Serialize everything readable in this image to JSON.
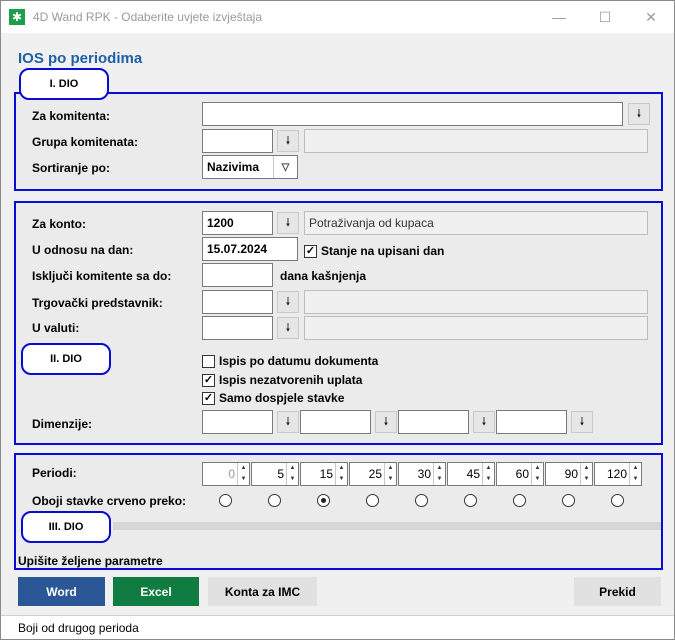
{
  "window": {
    "title": "4D Wand RPK - Odaberite uvjete izvještaja",
    "app_icon": "✱",
    "minimize": "—",
    "maximize": "☐",
    "close": "✕"
  },
  "page_title": "IOS po periodima",
  "section1": {
    "badge": "I. DIO",
    "za_komitenta_label": "Za komitenta:",
    "za_komitenta_value": "",
    "grupa_label": "Grupa komitenata:",
    "grupa_value": "",
    "grupa_desc": "",
    "sortiranje_label": "Sortiranje po:",
    "sortiranje_value": "Nazivima"
  },
  "section2": {
    "badge": "II. DIO",
    "za_konto_label": "Za konto:",
    "za_konto_value": "1200",
    "za_konto_desc": "Potraživanja od kupaca",
    "u_odnosu_label": "U odnosu na dan:",
    "u_odnosu_value": "15.07.2024",
    "stanje_label": "Stanje na upisani dan",
    "iskljuci_label": "Isključi komitente sa do:",
    "iskljuci_value": "",
    "dana_kasnjenja": "dana kašnjenja",
    "trgovacki_label": "Trgovački predstavnik:",
    "trgovacki_value": "",
    "trgovacki_desc": "",
    "u_valuti_label": "U valuti:",
    "u_valuti_value": "",
    "u_valuti_desc": "",
    "ispis_datum_label": "Ispis po datumu dokumenta",
    "ispis_uplata_label": "Ispis nezatvorenih uplata",
    "dospjele_label": "Samo dospjele stavke",
    "dimenzije_label": "Dimenzije:"
  },
  "section3": {
    "badge": "III. DIO",
    "periodi_label": "Periodi:",
    "periods": [
      "0",
      "5",
      "15",
      "25",
      "30",
      "45",
      "60",
      "90",
      "120"
    ],
    "oboji_label": "Oboji stavke crveno preko:",
    "selected_radio_index": 2,
    "hint": "Upišite željene parametre"
  },
  "checkboxes": {
    "stanje": true,
    "ispis_datum": false,
    "ispis_uplata": true,
    "dospjele": true
  },
  "buttons": {
    "word": "Word",
    "excel": "Excel",
    "konta": "Konta za IMC",
    "prekid": "Prekid"
  },
  "colors": {
    "word": "#2b5797",
    "excel": "#107c41",
    "panel_border": "#0b0bd6",
    "title": "#1f5fa6"
  },
  "status": "Boji od drugog perioda"
}
